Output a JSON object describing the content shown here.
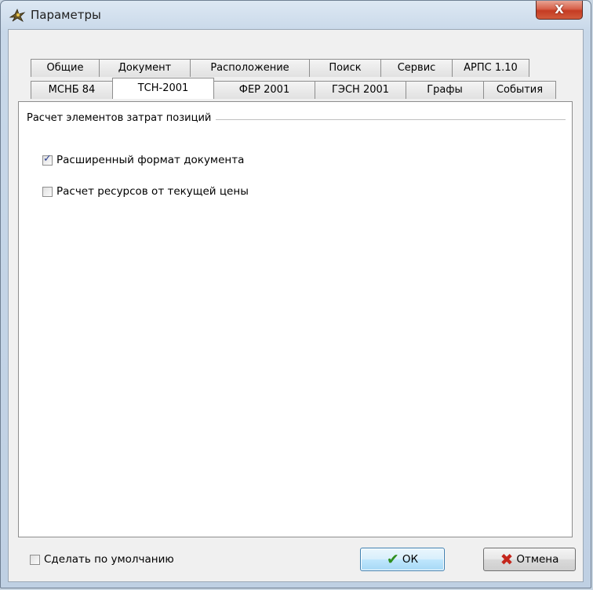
{
  "window": {
    "title": "Параметры",
    "close_label": "X"
  },
  "tabs_row1": [
    "Общие",
    "Документ",
    "Расположение",
    "Поиск",
    "Сервис",
    "АРПС 1.10"
  ],
  "tabs_row2": [
    "МСНБ 84",
    "ТСН-2001",
    "ФЕР 2001",
    "ГЭСН 2001",
    "Графы",
    "События"
  ],
  "active_tab": "ТСН-2001",
  "group": {
    "title": "Расчет элементов затрат позиций",
    "options": [
      {
        "label": "Расширенный формат документа",
        "checked": true
      },
      {
        "label": "Расчет ресурсов от текущей цены",
        "checked": false
      }
    ]
  },
  "footer": {
    "default_checkbox": {
      "label": "Сделать по умолчанию",
      "checked": false
    },
    "ok_label": "ОК",
    "cancel_label": "Отмена"
  },
  "colors": {
    "ok_icon": "#2f8f1f",
    "cancel_icon": "#c4261c",
    "close_button": "#c53c23"
  },
  "icons": {
    "app": "bird-icon",
    "ok": "checkmark-icon",
    "cancel": "cross-icon"
  }
}
